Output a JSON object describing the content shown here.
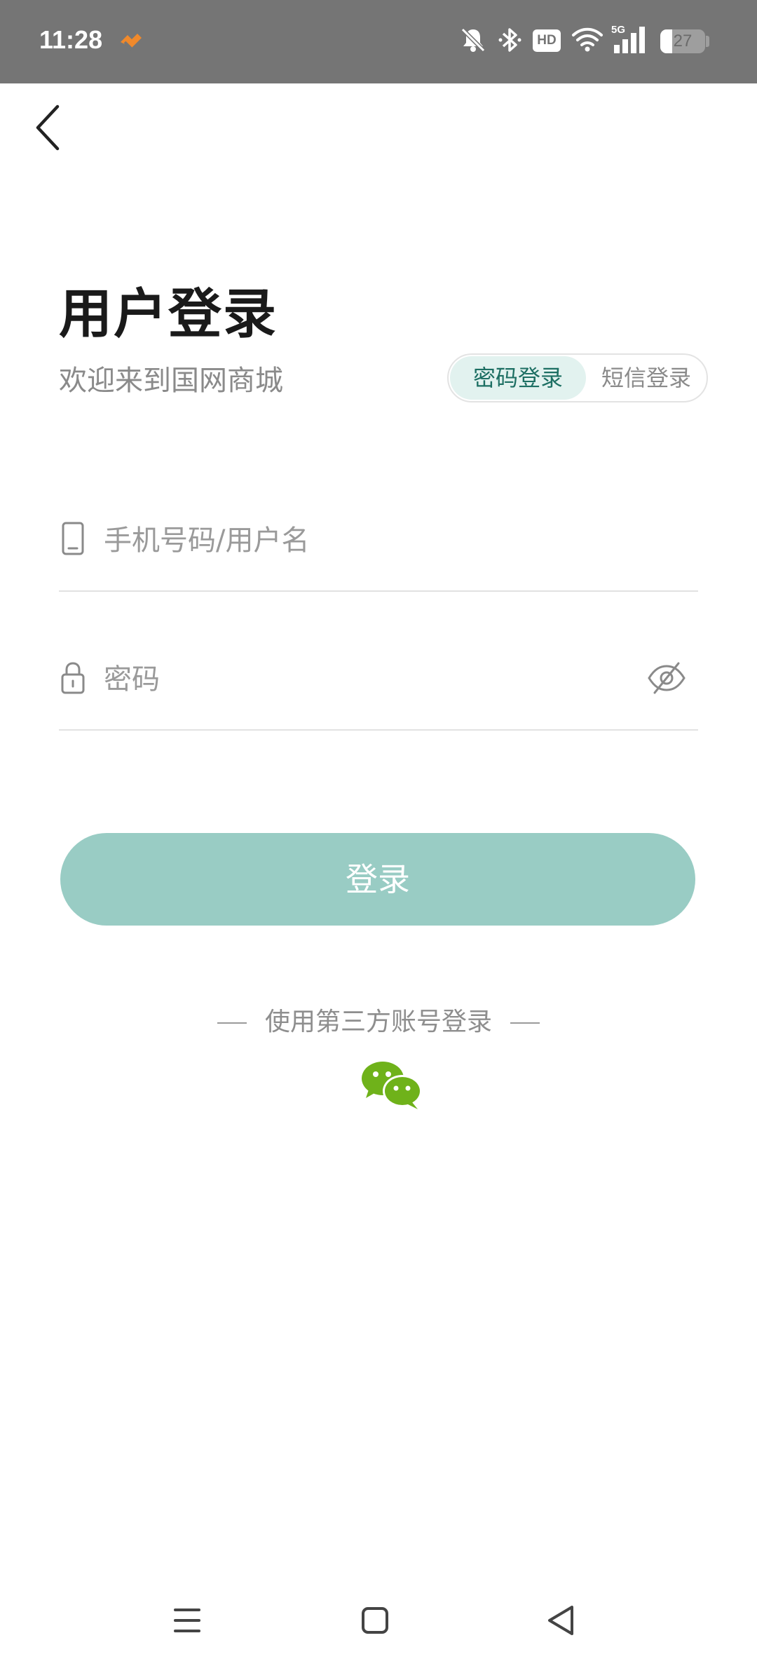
{
  "status_bar": {
    "time": "11:28",
    "battery_level": "27",
    "network": "5G",
    "hd_badge": "HD",
    "icons": [
      "app-notification-icon",
      "bell-muted-icon",
      "bluetooth-icon",
      "hd-icon",
      "wifi-icon",
      "signal-icon",
      "battery-icon"
    ]
  },
  "header": {
    "back_icon": "chevron-left-icon",
    "title": "用户登录",
    "subtitle": "欢迎来到国网商城"
  },
  "mode_toggle": {
    "options": [
      {
        "label": "密码登录",
        "active": true
      },
      {
        "label": "短信登录",
        "active": false
      }
    ]
  },
  "form": {
    "username": {
      "placeholder": "手机号码/用户名",
      "value": "",
      "icon": "phone-icon"
    },
    "password": {
      "placeholder": "密码",
      "value": "",
      "icon": "lock-icon",
      "toggle_icon": "eye-hidden-icon"
    },
    "submit_label": "登录"
  },
  "third_party": {
    "label": "使用第三方账号登录",
    "providers": [
      {
        "name": "wechat",
        "icon": "wechat-icon"
      }
    ]
  },
  "colors": {
    "accent": "#99ccc4",
    "accent_text": "#1d6f63",
    "toggle_active_bg": "#e2f2ef",
    "wechat": "#6fb21a",
    "status_bar_bg": "#757575"
  },
  "nav_bar": {
    "buttons": [
      "menu-icon",
      "home-icon",
      "back-triangle-icon"
    ]
  }
}
